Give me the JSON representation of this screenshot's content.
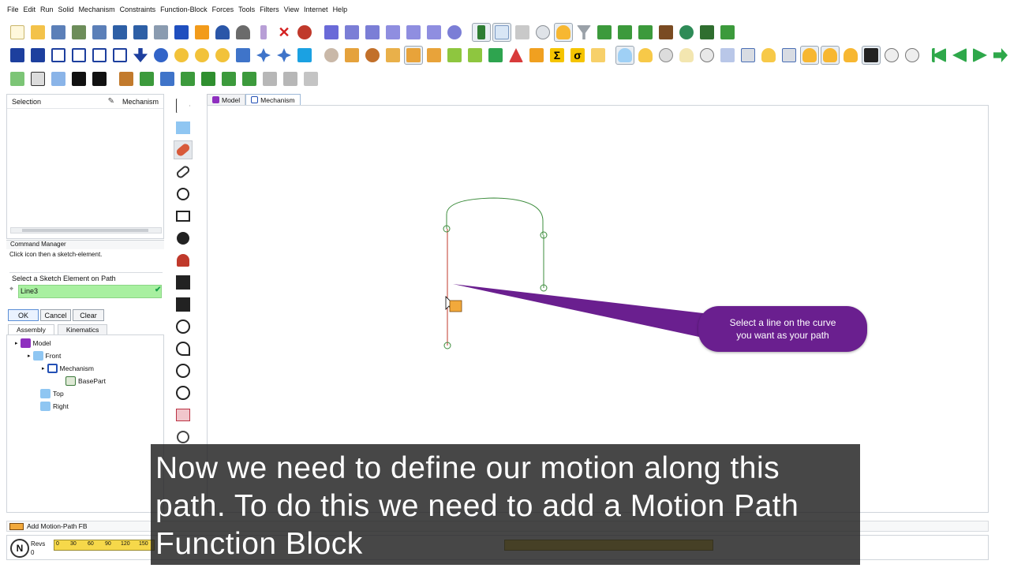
{
  "menu": [
    "File",
    "Edit",
    "Run",
    "Solid",
    "Mechanism",
    "Constraints",
    "Function-Block",
    "Forces",
    "Tools",
    "Filters",
    "View",
    "Internet",
    "Help"
  ],
  "selection_panel": {
    "title": "Selection",
    "mode_label": "Mechanism"
  },
  "command_manager": {
    "title": "Command Manager",
    "hint": "Click icon then a sketch-element.",
    "group_label": "Select a Sketch Element on Path",
    "field_value": "Line3",
    "ok_label": "OK",
    "cancel_label": "Cancel",
    "clear_label": "Clear"
  },
  "panel_tabs": [
    "Assembly",
    "Kinematics"
  ],
  "tree": [
    "Model",
    "Front",
    "Mechanism",
    "BasePart",
    "Top",
    "Right"
  ],
  "doc_tabs": [
    "Model",
    "Mechanism"
  ],
  "callout": {
    "line1": "Select a line on the curve",
    "line2": "you want as your path"
  },
  "status": {
    "text": "Add Motion-Path FB"
  },
  "motion": {
    "revs_label": "Revs",
    "revs_value": "0",
    "ruler_ticks": [
      "0",
      "30",
      "60",
      "90",
      "120",
      "150"
    ]
  },
  "subtitle": {
    "line1": "Now we need to define our motion along this",
    "line2": "path.  To do this we need to add a Motion Path",
    "line3": "Function Block"
  },
  "colors": {
    "accent": "#6a1f8f",
    "path_green": "#3c8c3c",
    "path_red": "#c0392b",
    "field_green": "#a8f0a0"
  }
}
